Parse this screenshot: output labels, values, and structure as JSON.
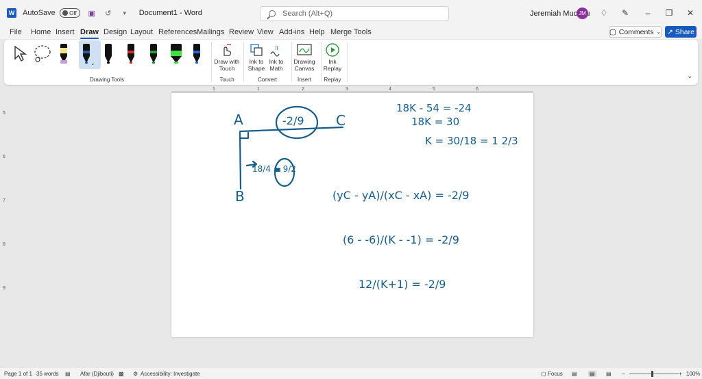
{
  "titlebar": {
    "app_icon": "word-icon",
    "autosave_label": "AutoSave",
    "autosave_state": "Off",
    "document_title": "Document1 - Word",
    "search_placeholder": "Search (Alt+Q)",
    "user_name": "Jeremiah Mucunu",
    "user_initials": "JM"
  },
  "menu": {
    "tabs": [
      "File",
      "Home",
      "Insert",
      "Draw",
      "Design",
      "Layout",
      "References",
      "Mailings",
      "Review",
      "View",
      "Add-ins",
      "Help",
      "Merge Tools"
    ],
    "active_tab": "Draw",
    "comments_label": "Comments",
    "share_label": "Share"
  },
  "ribbon": {
    "groups": [
      {
        "label": "Drawing Tools"
      },
      {
        "label": "Touch",
        "buttons": [
          {
            "label": "Draw with Touch",
            "icon": "draw-touch-icon"
          }
        ]
      },
      {
        "label": "Convert",
        "buttons": [
          {
            "label": "Ink to Shape",
            "icon": "ink-shape-icon"
          },
          {
            "label": "Ink to Math",
            "icon": "ink-math-icon"
          }
        ]
      },
      {
        "label": "Insert",
        "buttons": [
          {
            "label": "Drawing Canvas",
            "icon": "drawing-canvas-icon"
          }
        ]
      },
      {
        "label": "Replay",
        "buttons": [
          {
            "label": "Ink Replay",
            "icon": "ink-replay-icon"
          }
        ]
      }
    ],
    "pens": [
      {
        "name": "pencil",
        "color": "#111111",
        "band": "#f5e08a",
        "dot": "#c8a0d8"
      },
      {
        "name": "pen-blue",
        "color": "#111111",
        "band": "#1a5fa8",
        "dot": "#1a5fa8",
        "selected": true
      },
      {
        "name": "pen-black",
        "color": "#111111",
        "band": "#111111",
        "dot": "#111111"
      },
      {
        "name": "pen-red",
        "color": "#111111",
        "band": "#d42a2a",
        "dot": "#d42a2a"
      },
      {
        "name": "pen-green",
        "color": "#111111",
        "band": "#2a9a3a",
        "dot": "#2a9a3a"
      },
      {
        "name": "highlighter-green",
        "color": "#111111",
        "band": "#3de03d",
        "dot": "#3de03d"
      },
      {
        "name": "pen-galaxy",
        "color": "#111111",
        "band": "#2a5fd8",
        "dot": "#2a5fd8"
      }
    ]
  },
  "ruler": {
    "horizontal": [
      "1",
      "1",
      "2",
      "3",
      "4",
      "5",
      "6"
    ],
    "vertical": [
      "5",
      "6",
      "7",
      "8",
      "9"
    ]
  },
  "document": {
    "ink_color": "#155d8c",
    "labels": [
      "A",
      "C",
      "B"
    ],
    "slope_ac": "-2/9",
    "slope_ab": "18/4 = 9/2",
    "work_top": [
      "18K - 54 = -24",
      "18K = 30",
      "K = 30/18 = 1 2/3"
    ],
    "formula": "(yC - yA)/(xC - xA) = -2/9",
    "step1": "(6 - -6)/(K - -1) = -2/9",
    "step2": "12/(K+1) = -2/9"
  },
  "statusbar": {
    "page": "Page 1 of 1",
    "words": "35 words",
    "language": "Afar (Djibouti)",
    "accessibility": "Accessibility: Investigate",
    "focus": "Focus",
    "zoom": "100%"
  }
}
